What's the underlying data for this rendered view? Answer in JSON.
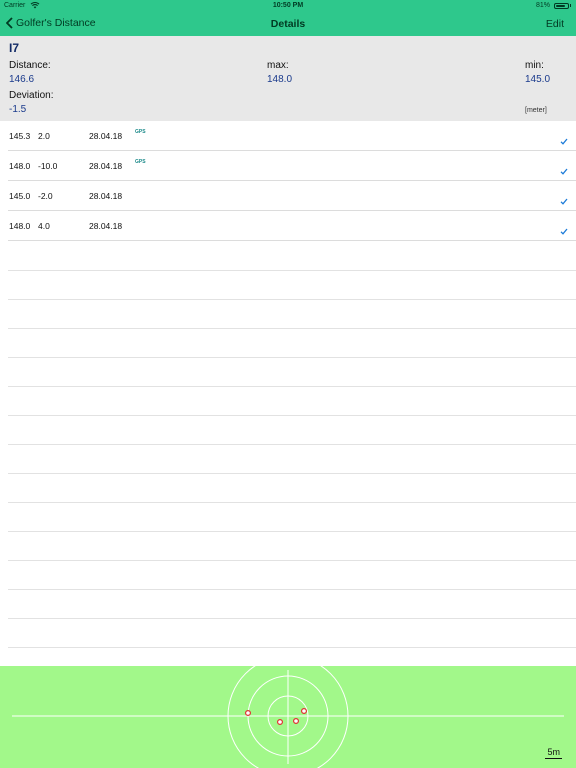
{
  "status": {
    "carrier": "Carrier",
    "time": "10:50 PM",
    "battery": "81%",
    "battery_level": 0.81
  },
  "nav": {
    "back_label": "Golfer's Distance",
    "title": "Details",
    "edit_label": "Edit"
  },
  "summary": {
    "club": "I7",
    "distance_label": "Distance:",
    "distance_value": "146.6",
    "max_label": "max:",
    "max_value": "148.0",
    "min_label": "min:",
    "min_value": "145.0",
    "deviation_label": "Deviation:",
    "deviation_value": "-1.5",
    "unit": "[meter]"
  },
  "shots": [
    {
      "distance": "145.3",
      "deviation": "2.0",
      "date": "28.04.18",
      "source": "GPS",
      "checked": true
    },
    {
      "distance": "148.0",
      "deviation": "-10.0",
      "date": "28.04.18",
      "source": "GPS",
      "checked": true
    },
    {
      "distance": "145.0",
      "deviation": "-2.0",
      "date": "28.04.18",
      "source": "",
      "checked": true
    },
    {
      "distance": "148.0",
      "deviation": "4.0",
      "date": "28.04.18",
      "source": "",
      "checked": true
    }
  ],
  "target": {
    "scale_label": "5m",
    "background_color": "#a2f88a",
    "dot_color": "#e03030"
  },
  "colors": {
    "accent": "#2ec88c",
    "value_text": "#1a3a8c",
    "checkmark": "#1a7ad8"
  }
}
